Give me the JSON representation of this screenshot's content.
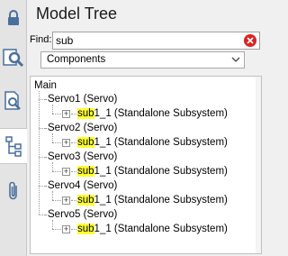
{
  "toolbar": {
    "buttons": [
      {
        "icon": "lock-icon"
      },
      {
        "icon": "search-tree-icon"
      },
      {
        "icon": "search-document-icon"
      },
      {
        "icon": "model-tree-icon",
        "active": true
      },
      {
        "icon": "paperclip-icon"
      }
    ]
  },
  "panel": {
    "title": "Model Tree",
    "find_label": "Find:",
    "find_value": "sub",
    "filter_selected": "Components"
  },
  "tree": {
    "root": "Main",
    "nodes": [
      {
        "label": "Servo1 (Servo)",
        "child_match": "sub",
        "child_rest": "1_1 (Standalone Subsystem)"
      },
      {
        "label": "Servo2 (Servo)",
        "child_match": "sub",
        "child_rest": "1_1 (Standalone Subsystem)"
      },
      {
        "label": "Servo3 (Servo)",
        "child_match": "sub",
        "child_rest": "1_1 (Standalone Subsystem)"
      },
      {
        "label": "Servo4 (Servo)",
        "child_match": "sub",
        "child_rest": "1_1 (Standalone Subsystem)"
      },
      {
        "label": "Servo5 (Servo)",
        "child_match": "sub",
        "child_rest": "1_1 (Standalone Subsystem)"
      }
    ]
  },
  "colors": {
    "highlight": "#ffff33",
    "clear_button": "#e02020",
    "active_tool": "#ffffff"
  }
}
